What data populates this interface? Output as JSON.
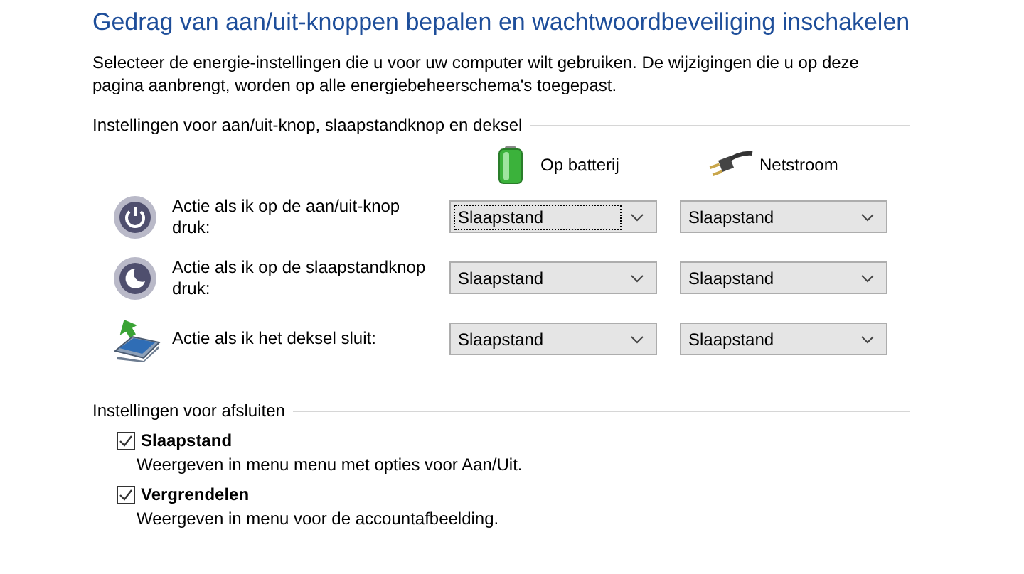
{
  "title": "Gedrag van aan/uit-knoppen bepalen en wachtwoordbeveiliging inschakelen",
  "description": "Selecteer de energie-instellingen die u voor uw computer wilt gebruiken. De wijzigingen die u op deze pagina aanbrengt, worden op alle energiebeheerschema's toegepast.",
  "buttons_section": {
    "heading": "Instellingen voor aan/uit-knop, slaapstandknop en deksel",
    "columns": [
      {
        "kind": "battery",
        "label": "Op batterij"
      },
      {
        "kind": "plug",
        "label": "Netstroom"
      }
    ],
    "rows": [
      {
        "kind": "power",
        "label": "Actie als ik op de aan/uit-knop druk:",
        "values": [
          {
            "value": "Slaapstand",
            "focused": true
          },
          {
            "value": "Slaapstand",
            "focused": false
          }
        ]
      },
      {
        "kind": "sleep",
        "label": "Actie als ik op de slaapstandknop druk:",
        "values": [
          {
            "value": "Slaapstand",
            "focused": false
          },
          {
            "value": "Slaapstand",
            "focused": false
          }
        ]
      },
      {
        "kind": "lid",
        "label": "Actie als ik het deksel sluit:",
        "values": [
          {
            "value": "Slaapstand",
            "focused": false
          },
          {
            "value": "Slaapstand",
            "focused": false
          }
        ]
      }
    ]
  },
  "shutdown_section": {
    "heading": "Instellingen voor afsluiten",
    "options": [
      {
        "label": "Slaapstand",
        "description": "Weergeven in menu menu met opties voor Aan/Uit.",
        "checked": true
      },
      {
        "label": "Vergrendelen",
        "description": "Weergeven in menu voor de accountafbeelding.",
        "checked": true
      }
    ]
  }
}
